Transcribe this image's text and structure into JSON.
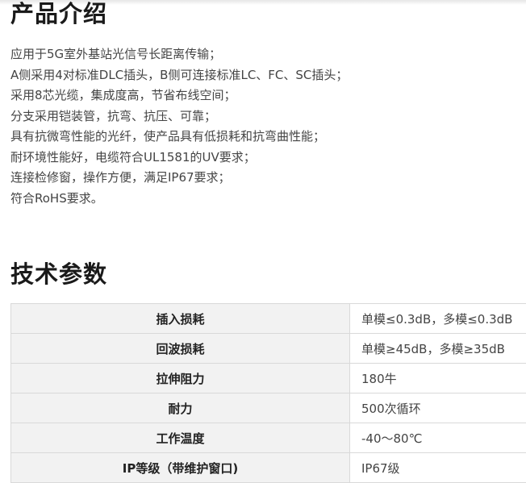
{
  "intro": {
    "title": "产品介绍",
    "items": [
      "应用于5G室外基站光信号长距离传输；",
      "A侧采用4对标准DLC插头，B侧可连接标准LC、FC、SC插头；",
      "采用8芯光缆，集成度高，节省布线空间；",
      "分支采用铠装管，抗弯、抗压、可靠；",
      "具有抗微弯性能的光纤，使产品具有低损耗和抗弯曲性能；",
      "耐环境性能好，电缆符合UL1581的UV要求；",
      "连接检修窗，操作方便，满足IP67要求；",
      "符合RoHS要求。"
    ]
  },
  "specs": {
    "title": "技术参数",
    "rows": [
      {
        "name": "插入损耗",
        "value": "单模≤0.3dB，多模≤0.3dB"
      },
      {
        "name": "回波损耗",
        "value": "单模≥45dB，多模≥35dB"
      },
      {
        "name": "拉伸阻力",
        "value": "180牛"
      },
      {
        "name": "耐力",
        "value": "500次循环"
      },
      {
        "name": "工作温度",
        "value": "-40～80℃"
      },
      {
        "name": "IP等级（带维护窗口)",
        "value": "IP67级"
      }
    ]
  }
}
